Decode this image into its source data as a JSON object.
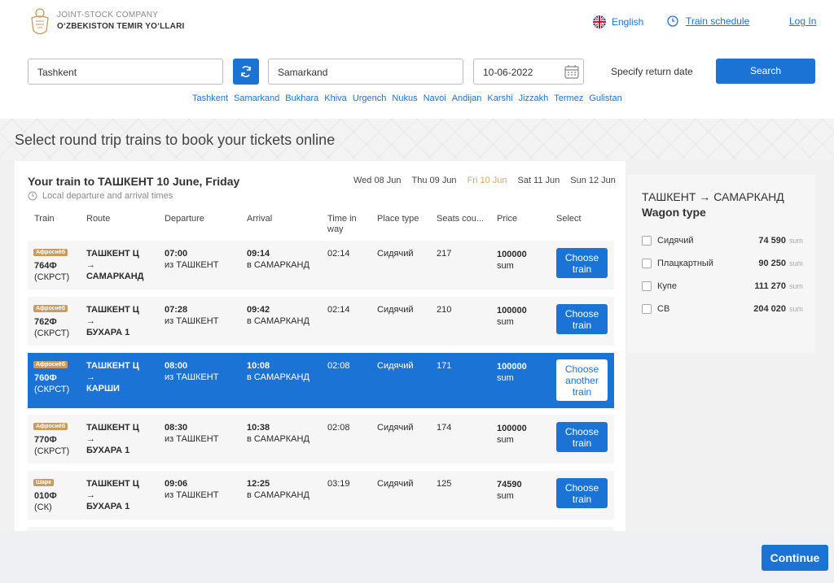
{
  "header": {
    "company_line1": "JOINT-STOCK COMPANY",
    "company_line2": "O‘ZBEKISTON TEMIR YO‘LLARI",
    "language": "English",
    "schedule": "Train schedule",
    "login": "Log In"
  },
  "search": {
    "from": "Tashkent",
    "to": "Samarkand",
    "date": "10-06-2022",
    "return_label": "Specify return date",
    "button": "Search",
    "cities": [
      "Tashkent",
      "Samarkand",
      "Bukhara",
      "Khiva",
      "Urgench",
      "Nukus",
      "Navoi",
      "Andijan",
      "Karshi",
      "Jizzakh",
      "Termez",
      "Gulistan"
    ]
  },
  "page_title": "Select round trip trains to book your tickets online",
  "trains": {
    "heading": "Your train to ТАШКЕНТ 10 June, Friday",
    "local_note": "Local departure and arrival times",
    "dates": [
      "Wed 08 Jun",
      "Thu 09 Jun",
      "Fri 10 Jun",
      "Sat 11 Jun",
      "Sun 12 Jun"
    ],
    "active_date": "Fri 10 Jun",
    "columns": {
      "train": "Train",
      "route": "Route",
      "departure": "Departure",
      "arrival": "Arrival",
      "time_in_way": "Time in way",
      "place_type": "Place type",
      "seats": "Seats cou...",
      "price": "Price",
      "select": "Select"
    },
    "rows": [
      {
        "badge": "Афросиёб",
        "number": "764Ф",
        "type": "(СКРСТ)",
        "route_from": "ТАШКЕНТ Ц",
        "arrow": "→",
        "route_to": "САМАРКАНД",
        "dep_time": "07:00",
        "dep_place": "из ТАШКЕНТ",
        "arr_time": "09:14",
        "arr_place": "в САМАРКАНД",
        "duration": "02:14",
        "place_type": "Сидячий",
        "seats": "217",
        "price": "100000",
        "currency": "sum",
        "button": "Choose train"
      },
      {
        "badge": "Афросиёб",
        "number": "762Ф",
        "type": "(СКРСТ)",
        "route_from": "ТАШКЕНТ Ц",
        "arrow": "→",
        "route_to": "БУХАРА 1",
        "dep_time": "07:28",
        "dep_place": "из ТАШКЕНТ",
        "arr_time": "09:42",
        "arr_place": "в САМАРКАНД",
        "duration": "02:14",
        "place_type": "Сидячий",
        "seats": "210",
        "price": "100000",
        "currency": "sum",
        "button": "Choose train"
      },
      {
        "badge": "Афросиёб",
        "number": "760Ф",
        "type": "(СКРСТ)",
        "route_from": "ТАШКЕНТ Ц",
        "arrow": "→",
        "route_to": "КАРШИ",
        "dep_time": "08:00",
        "dep_place": "из ТАШКЕНТ",
        "arr_time": "10:08",
        "arr_place": "в САМАРКАНД",
        "duration": "02:08",
        "place_type": "Сидячий",
        "seats": "171",
        "price": "100000",
        "currency": "sum",
        "button": "Choose another train"
      },
      {
        "badge": "Афросиёб",
        "number": "770Ф",
        "type": "(СКРСТ)",
        "route_from": "ТАШКЕНТ Ц",
        "arrow": "→",
        "route_to": "БУХАРА 1",
        "dep_time": "08:30",
        "dep_place": "из ТАШКЕНТ",
        "arr_time": "10:38",
        "arr_place": "в САМАРКАНД",
        "duration": "02:08",
        "place_type": "Сидячий",
        "seats": "174",
        "price": "100000",
        "currency": "sum",
        "button": "Choose train"
      },
      {
        "badge": "Шарк",
        "number": "010Ф",
        "type": "(СК)",
        "route_from": "ТАШКЕНТ Ц",
        "arrow": "→",
        "route_to": "БУХАРА 1",
        "dep_time": "09:06",
        "dep_place": "из ТАШКЕНТ",
        "arr_time": "12:25",
        "arr_place": "в САМАРКАНД",
        "duration": "03:19",
        "place_type": "Сидячий",
        "seats": "125",
        "price": "74590",
        "currency": "sum",
        "button": "Choose train"
      }
    ],
    "selected_row": 2
  },
  "wagon": {
    "title": "ТАШКЕНТ → САМАРКАНД",
    "subtitle": "Wagon type",
    "items": [
      {
        "name": "Сидячий",
        "price": "74 590",
        "unit": "sum"
      },
      {
        "name": "Плацкартный",
        "price": "90 250",
        "unit": "sum"
      },
      {
        "name": "Купе",
        "price": "111 270",
        "unit": "sum"
      },
      {
        "name": "СВ",
        "price": "204 020",
        "unit": "sum"
      }
    ]
  },
  "footer": {
    "continue": "Continue"
  },
  "colors": {
    "accent": "#1c73d6",
    "badge": "#c99b5f",
    "active_date": "#d8a660"
  }
}
